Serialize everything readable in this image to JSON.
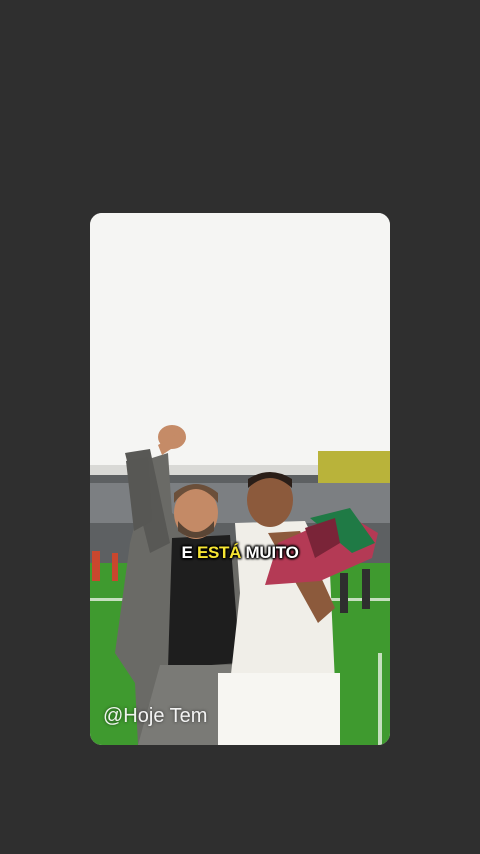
{
  "caption": {
    "part1": "E ",
    "highlight": "ESTÁ",
    "part2": " MUITO"
  },
  "watermark": "@Hoje Tem",
  "colors": {
    "background": "#2f2f2f",
    "highlight": "#f6e533",
    "pitch": "#3f9a2f"
  }
}
